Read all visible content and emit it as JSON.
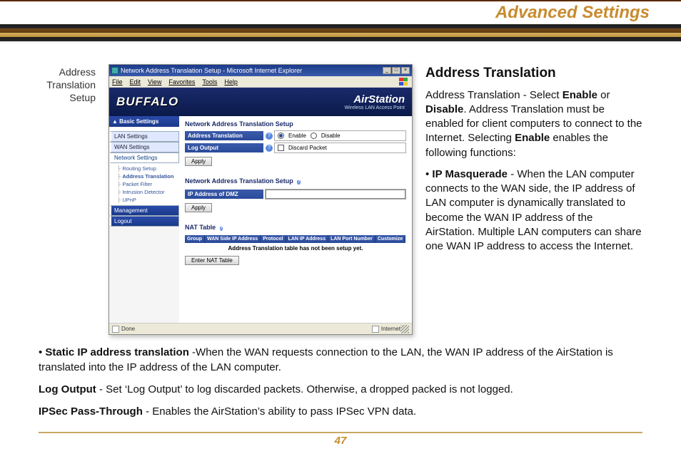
{
  "page": {
    "header_title": "Advanced Settings",
    "page_number": "47"
  },
  "left_caption": "Address Translation Setup",
  "screenshot": {
    "window_title": "Network Address Translation Setup - Microsoft Internet Explorer",
    "menubar": {
      "file": "File",
      "edit": "Edit",
      "view": "View",
      "favorites": "Favorites",
      "tools": "Tools",
      "help": "Help"
    },
    "banner_logo": "BUFFALO",
    "banner_product": "AirStation",
    "banner_sub": "Wireless LAN Access Point",
    "sidebar": {
      "basic": "▲ Basic Settings",
      "items": [
        {
          "label": "LAN Settings"
        },
        {
          "label": "WAN Settings"
        },
        {
          "label": "Network Settings"
        }
      ],
      "tree": [
        "Routing Setup",
        "Address Translation",
        "Packet Filter",
        "Intrusion Detector",
        "UPnP"
      ],
      "management": "Management",
      "logout": "Logout"
    },
    "main": {
      "section1_title": "Network Address Translation Setup",
      "row_addr_trans": "Address Translation",
      "opt_enable": "Enable",
      "opt_disable": "Disable",
      "row_log_output": "Log Output",
      "opt_discard": "Discard Packet",
      "btn_apply": "Apply",
      "section2_title": "Network Address Translation Setup",
      "row_dmz": "IP Address of DMZ",
      "nat_table_title": "NAT Table",
      "tbl_headers": [
        "Group",
        "WAN Side IP Address",
        "Protocol",
        "LAN IP Address",
        "LAN Port Number",
        "Customize"
      ],
      "tbl_empty": "Address Translation table has not been setup yet.",
      "btn_enter_nat": "Enter NAT Table"
    },
    "status_done": "Done",
    "status_zone": "Internet"
  },
  "description": {
    "heading": "Address Translation",
    "p1_a": "Address Translation - Select ",
    "p1_enable": "Enable",
    "p1_or": " or ",
    "p1_disable": "Disable",
    "p1_b": ".  Address Translation must be enabled for client computers to connect to the Internet.  Selecting ",
    "p1_enable2": "Enable",
    "p1_c": " enables the following functions:",
    "p2_bullet": "• ",
    "p2_bold": "IP Masquerade",
    "p2_txt": " - When the LAN computer connects to the WAN side, the IP address of LAN computer is dynamically translated to become the WAN IP address of the AirStation.  Multiple LAN computers can share one WAN IP address to access the Internet.",
    "p3_bullet": "• ",
    "p3_bold": "Static IP address translation",
    "p3_txt": " -When the WAN requests connection to the LAN, the WAN IP address of the AirStation is translated into the IP address of the LAN computer.",
    "p4_bold": "Log Output",
    "p4_txt": " - Set ‘Log Output’ to log discarded packets.  Otherwise, a dropped packed is not logged.",
    "p5_bold": "IPSec Pass-Through",
    "p5_txt": " - Enables the AirStation’s ability to pass IPSec VPN data."
  }
}
